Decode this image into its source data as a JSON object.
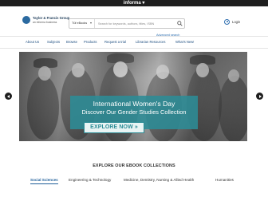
{
  "topbar": {
    "brand": "informa ▾"
  },
  "header": {
    "logo": {
      "line1": "Taylor & Francis Group",
      "line2": "an informa business"
    },
    "search": {
      "scope": "Tüf eBooks",
      "placeholder": "Search for keywords, authors, titles, ISBN"
    },
    "advanced_search": "Advanced search",
    "login": "Login"
  },
  "nav": {
    "items": [
      {
        "label": "About Us"
      },
      {
        "label": "Subjects"
      },
      {
        "label": "Browse"
      },
      {
        "label": "Products"
      },
      {
        "label": "Request a trial"
      },
      {
        "label": "Librarian Resources"
      },
      {
        "label": "What's New!"
      }
    ]
  },
  "banner": {
    "headline": "International Women's Day",
    "subline": "Discover Our Gender Studies Collection",
    "cta": "EXPLORE NOW »",
    "accent_color": "#2c8c96"
  },
  "collections": {
    "title": "EXPLORE OUR EBOOK COLLECTIONS",
    "tabs": [
      {
        "label": "Social Sciences",
        "active": true
      },
      {
        "label": "Engineering & Technology",
        "active": false
      },
      {
        "label": "Medicine, Dentistry, Nursing & Allied Health",
        "active": false
      },
      {
        "label": "Humanities",
        "active": false
      }
    ]
  }
}
